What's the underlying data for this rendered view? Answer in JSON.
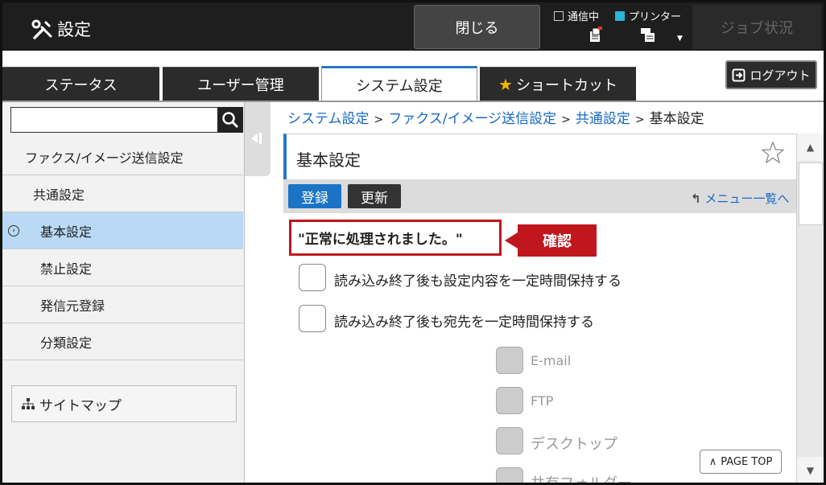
{
  "header": {
    "title": "設定",
    "close_label": "閉じる",
    "status_fax": "通信中",
    "status_printer": "プリンター",
    "job_status_label": "ジョブ状況",
    "printer_color": "#2ab5d1"
  },
  "tabs": [
    {
      "label": "ステータス"
    },
    {
      "label": "ユーザー管理"
    },
    {
      "label": "システム設定"
    },
    {
      "label": "ショートカット"
    }
  ],
  "logout_label": "ログアウト",
  "sidebar": {
    "search_value": "",
    "items": [
      {
        "label": "ファクス/イメージ送信設定"
      },
      {
        "label": "共通設定"
      },
      {
        "label": "基本設定"
      },
      {
        "label": "禁止設定"
      },
      {
        "label": "発信元登録"
      },
      {
        "label": "分類設定"
      }
    ],
    "sitemap_label": "サイトマップ"
  },
  "breadcrumb": {
    "items": [
      "システム設定",
      "ファクス/イメージ送信設定",
      "共通設定",
      "基本設定"
    ],
    "sep": ">"
  },
  "page": {
    "title": "基本設定",
    "register_label": "登録",
    "update_label": "更新",
    "menu_list_label": "メニュー一覧へ",
    "message": "\"正常に処理されました。\"",
    "confirm_label": "確認",
    "options": [
      {
        "label": "読み込み終了後も設定内容を一定時間保持する"
      },
      {
        "label": "読み込み終了後も宛先を一定時間保持する"
      }
    ],
    "sub_options": [
      {
        "label": "E-mail"
      },
      {
        "label": "FTP"
      },
      {
        "label": "デスクトップ"
      },
      {
        "label": "共有フォルダー"
      }
    ],
    "page_top_label": "PAGE TOP"
  },
  "colors": {
    "accent": "#2877c6",
    "alert": "#c0161d",
    "selected_row": "#b9d9f4",
    "link": "#1769c5"
  }
}
